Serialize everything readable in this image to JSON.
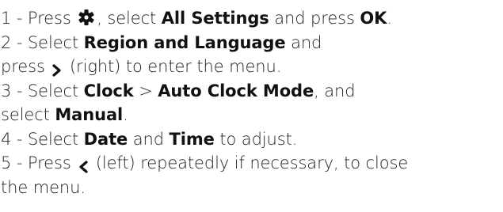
{
  "steps": [
    {
      "num": "1 -",
      "l1_a": " Press ",
      "icon": "gear-icon",
      "l1_b": ", select ",
      "l1_c": "All Settings",
      "l1_d": " and press ",
      "l1_e": "OK",
      "l1_f": "."
    },
    {
      "num": "2 -",
      "l1_a": " Select ",
      "l1_b": "Region and Language",
      "l1_c": " and",
      "l2_a": "press ",
      "icon": "chevron-right-icon",
      "l2_b": " (right) to enter the menu."
    },
    {
      "num": "3 -",
      "l1_a": " Select ",
      "l1_b": "Clock",
      "l1_c": " > ",
      "l1_d": "Auto Clock Mode",
      "l1_e": ", and",
      "l2_a": "select ",
      "l2_b": "Manual",
      "l2_c": "."
    },
    {
      "num": "4 -",
      "l1_a": " Select ",
      "l1_b": "Date",
      "l1_c": " and ",
      "l1_d": "Time",
      "l1_e": " to adjust."
    },
    {
      "num": "5 -",
      "l1_a": " Press ",
      "icon": "chevron-left-icon",
      "l1_b": " (left) repeatedly if necessary, to close",
      "l2_a": "the menu."
    }
  ],
  "colors": {
    "text": "#222222",
    "bold_text": "#111111",
    "background": "#ffffff"
  }
}
